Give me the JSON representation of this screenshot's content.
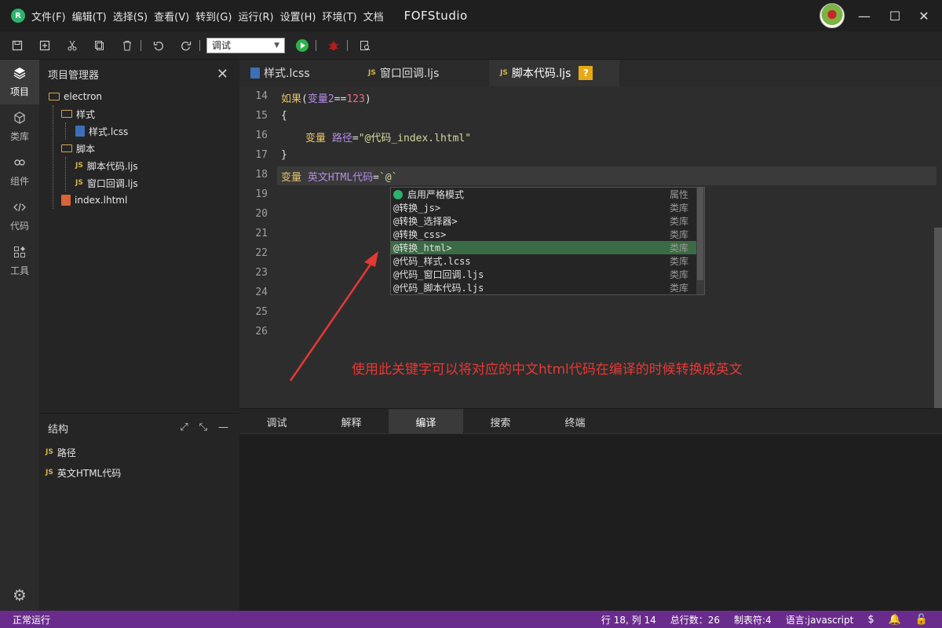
{
  "titlebar": {
    "menu": [
      "文件(F)",
      "编辑(T)",
      "选择(S)",
      "查看(V)",
      "转到(G)",
      "运行(R)",
      "设置(H)",
      "环境(T)",
      "文档"
    ],
    "app_title": "FOFStudio",
    "minimize": "—",
    "maximize": "☐",
    "close": "✕"
  },
  "toolbar": {
    "config_value": "调试"
  },
  "activity": [
    {
      "label": "项目",
      "icon": "layers-icon"
    },
    {
      "label": "类库",
      "icon": "cube-icon"
    },
    {
      "label": "组件",
      "icon": "link-icon"
    },
    {
      "label": "代码",
      "icon": "code-icon"
    },
    {
      "label": "工具",
      "icon": "tools-icon"
    }
  ],
  "explorer": {
    "title": "项目管理器",
    "tree": {
      "root": "electron",
      "style_folder": "样式",
      "style_file": "样式.lcss",
      "script_folder": "脚本",
      "script_file1": "脚本代码.ljs",
      "script_file2": "窗口回调.ljs",
      "html_file": "index.lhtml"
    },
    "js_tag": "JS"
  },
  "structure": {
    "title": "结构",
    "items": [
      "路径",
      "英文HTML代码"
    ]
  },
  "tabs": [
    {
      "label": "样式.lcss"
    },
    {
      "label": "窗口回调.ljs"
    },
    {
      "label": "脚本代码.ljs",
      "badge": "?"
    }
  ],
  "editor": {
    "line_numbers": [
      "14",
      "15",
      "16",
      "17",
      "18",
      "19",
      "20",
      "21",
      "22",
      "23",
      "24",
      "25",
      "26"
    ],
    "line14": {
      "kw": "如果",
      "p1": "(",
      "var": "变量2",
      "op": "==",
      "num": "123",
      "p2": ")"
    },
    "line15": "{",
    "line16": {
      "kw": "变量",
      "var": "路径",
      "op": "=",
      "str": "\"@代码_index.lhtml\""
    },
    "line17": "}",
    "line18": {
      "kw": "变量",
      "var": "英文HTML代码",
      "op": "=",
      "str": "`@`"
    }
  },
  "autocomplete": [
    {
      "label": "启用严格模式",
      "kind": "属性"
    },
    {
      "label": "@转换_js>",
      "kind": "类库"
    },
    {
      "label": "@转换_选择器>",
      "kind": "类库"
    },
    {
      "label": "@转换_css>",
      "kind": "类库"
    },
    {
      "label": "@转换_html>",
      "kind": "类库"
    },
    {
      "label": "@代码_样式.lcss",
      "kind": "类库"
    },
    {
      "label": "@代码_窗口回调.ljs",
      "kind": "类库"
    },
    {
      "label": "@代码_脚本代码.ljs",
      "kind": "类库"
    }
  ],
  "annotation": "使用此关键字可以将对应的中文html代码在编译的时候转换成英文",
  "bottom_tabs": [
    "调试",
    "解释",
    "编译",
    "搜索",
    "终端"
  ],
  "statusbar": {
    "left": "正常运行",
    "position": "行 18, 列 14",
    "total_lines": "总行数：26",
    "tab": "制表符:4",
    "language": "语言:javascript"
  },
  "colors": {
    "statusbar": "#6a2c8c",
    "accent_green": "#2bb36b",
    "selection": "#3b6b45",
    "annotation": "#e53935"
  }
}
